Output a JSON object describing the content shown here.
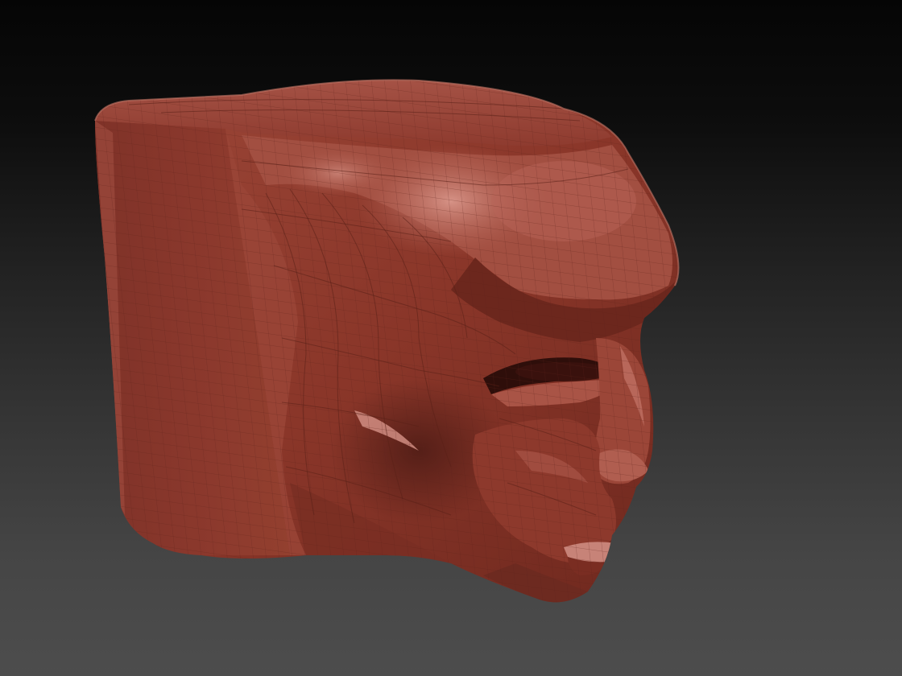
{
  "viewport": {
    "background_top": "#050505",
    "background_bottom": "#4d4d4d"
  },
  "model": {
    "material_base": "#8e3a2e",
    "material_light": "#c06a5c",
    "material_highlight": "#d99a8f",
    "material_shadow": "#4a1a14",
    "wireframe_color": "#6b2a20"
  }
}
